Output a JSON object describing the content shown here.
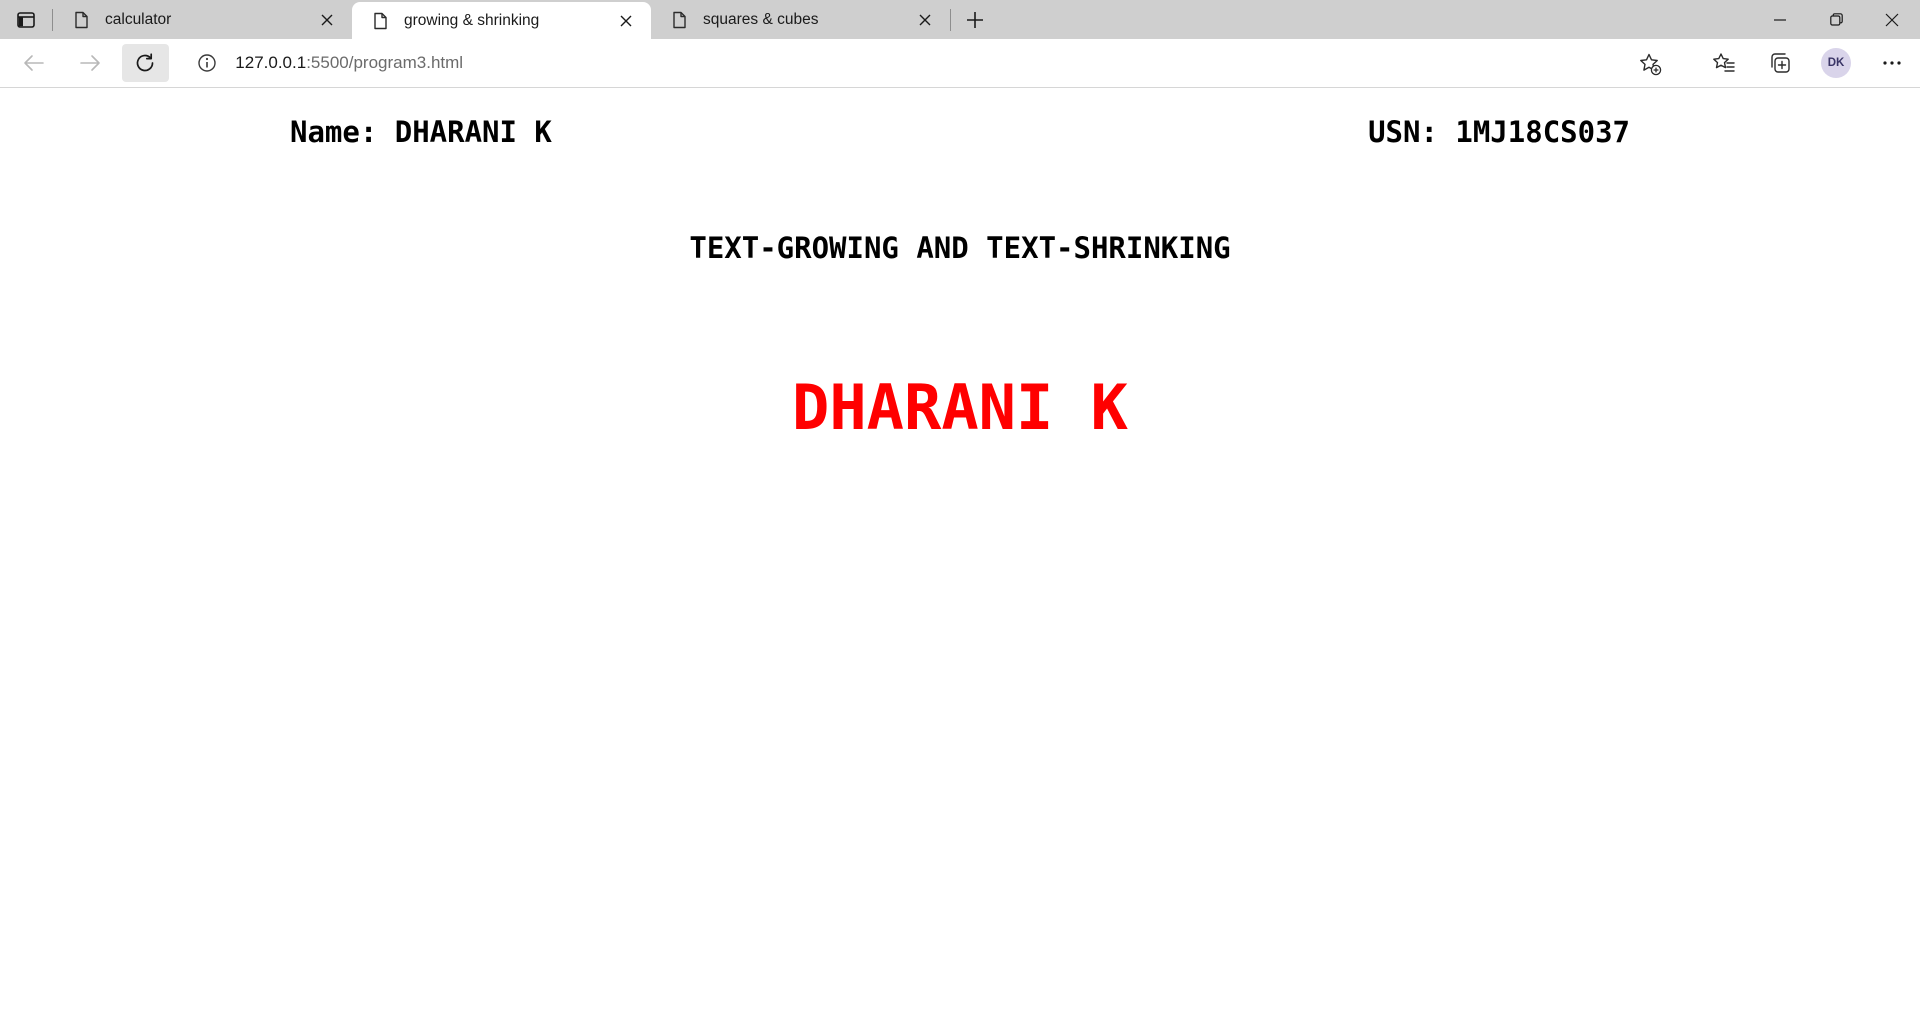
{
  "browser": {
    "tabs": [
      {
        "title": "calculator",
        "active": false
      },
      {
        "title": "growing & shrinking",
        "active": true
      },
      {
        "title": "squares & cubes",
        "active": false
      }
    ],
    "address": {
      "host": "127.0.0.1",
      "path": ":5500/program3.html"
    },
    "profile_initials": "DK"
  },
  "page": {
    "name_line": "Name: DHARANI K",
    "usn_line": "USN: 1MJ18CS037",
    "heading": "TEXT-GROWING AND TEXT-SHRINKING",
    "animated_text": "DHARANI K",
    "animated_text_color": "#ff0000"
  },
  "icons": {
    "tab_actions": "tab-actions-icon",
    "favicon": "page-icon",
    "close": "close-icon",
    "new_tab": "plus-icon",
    "back": "back-arrow-icon",
    "forward": "forward-arrow-icon",
    "refresh": "refresh-icon",
    "site_info": "info-icon",
    "add_favorite": "star-plus-icon",
    "favorites": "favorites-icon",
    "collections": "collections-icon",
    "more": "more-icon"
  }
}
